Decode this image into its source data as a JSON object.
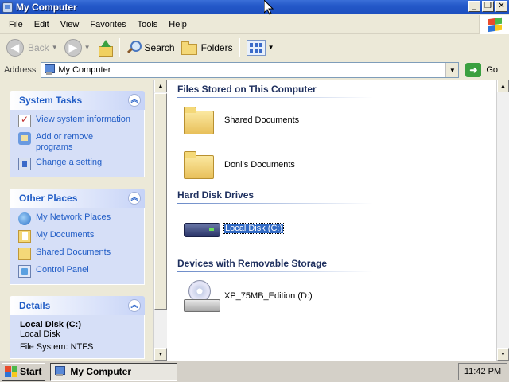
{
  "window": {
    "title": "My Computer"
  },
  "menu": [
    "File",
    "Edit",
    "View",
    "Favorites",
    "Tools",
    "Help"
  ],
  "toolbar": {
    "back_label": "Back",
    "search_label": "Search",
    "folders_label": "Folders"
  },
  "address": {
    "label": "Address",
    "value": "My Computer",
    "go_label": "Go"
  },
  "sidebar": {
    "system_tasks": {
      "title": "System Tasks",
      "items": [
        {
          "label": "View system information",
          "icon": "system-info-icon"
        },
        {
          "label": "Add or remove programs",
          "icon": "add-remove-programs-icon"
        },
        {
          "label": "Change a setting",
          "icon": "control-panel-icon"
        }
      ]
    },
    "other_places": {
      "title": "Other Places",
      "items": [
        {
          "label": "My Network Places",
          "icon": "network-places-icon"
        },
        {
          "label": "My Documents",
          "icon": "my-documents-icon"
        },
        {
          "label": "Shared Documents",
          "icon": "shared-folder-icon"
        },
        {
          "label": "Control Panel",
          "icon": "control-panel-icon"
        }
      ]
    },
    "details": {
      "title": "Details",
      "name": "Local Disk (C:)",
      "type": "Local Disk",
      "filesystem": "File System: NTFS"
    }
  },
  "main": {
    "groups": [
      {
        "title": "Files Stored on This Computer",
        "items": [
          {
            "label": "Shared Documents",
            "icon": "folder-icon"
          },
          {
            "label": "Doni's Documents",
            "icon": "folder-icon"
          }
        ]
      },
      {
        "title": "Hard Disk Drives",
        "items": [
          {
            "label": "Local Disk (C:)",
            "icon": "hard-disk-icon",
            "selected": true
          }
        ]
      },
      {
        "title": "Devices with Removable Storage",
        "items": [
          {
            "label": "XP_75MB_Edition (D:)",
            "icon": "cd-drive-icon"
          }
        ]
      }
    ]
  },
  "taskbar": {
    "start_label": "Start",
    "active_window": "My Computer",
    "clock": "11:42 PM"
  },
  "colors": {
    "titlebar": "#2458c8",
    "selection": "#316ac5",
    "panel_link": "#215dc6"
  }
}
